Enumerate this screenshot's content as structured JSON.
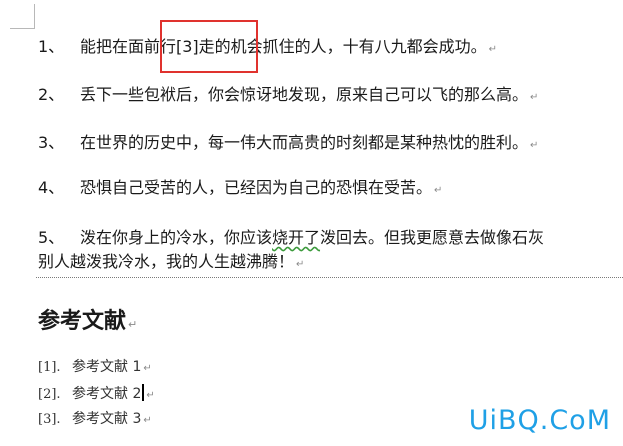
{
  "paragraphs": [
    {
      "num": "1、",
      "text": "能把在面前行[3]走的机会抓住的人，十有八九都会成功。"
    },
    {
      "num": "2、",
      "text": "丢下一些包袱后，你会惊讶地发现，原来自己可以飞的那么高。"
    },
    {
      "num": "3、",
      "text": "在世界的历史中，每一伟大而高贵的时刻都是某种热忱的胜利。"
    },
    {
      "num": "4、",
      "text": "恐惧自己受苦的人，已经因为自己的恐惧在受苦。"
    },
    {
      "num": "5、",
      "text_before": "泼在你身上的冷水，你应该",
      "text_wavy": "烧开了",
      "text_after": "泼回去。但我更愿意去做像石灰",
      "continuation": "别人越泼我冷水，我的人生越沸腾！"
    }
  ],
  "paragraph_mark": "↵",
  "references": {
    "heading": "参考文献",
    "items": [
      {
        "num": "[1].",
        "text": "参考文献 1"
      },
      {
        "num": "[2].",
        "text": "参考文献 2"
      },
      {
        "num": "[3].",
        "text": "参考文献 3"
      }
    ]
  },
  "watermark": "UiBQ.CoM",
  "colors": {
    "highlight": "#e0322e",
    "watermark": "#1fa0e6",
    "spell_underline": "#3c9a3c"
  }
}
